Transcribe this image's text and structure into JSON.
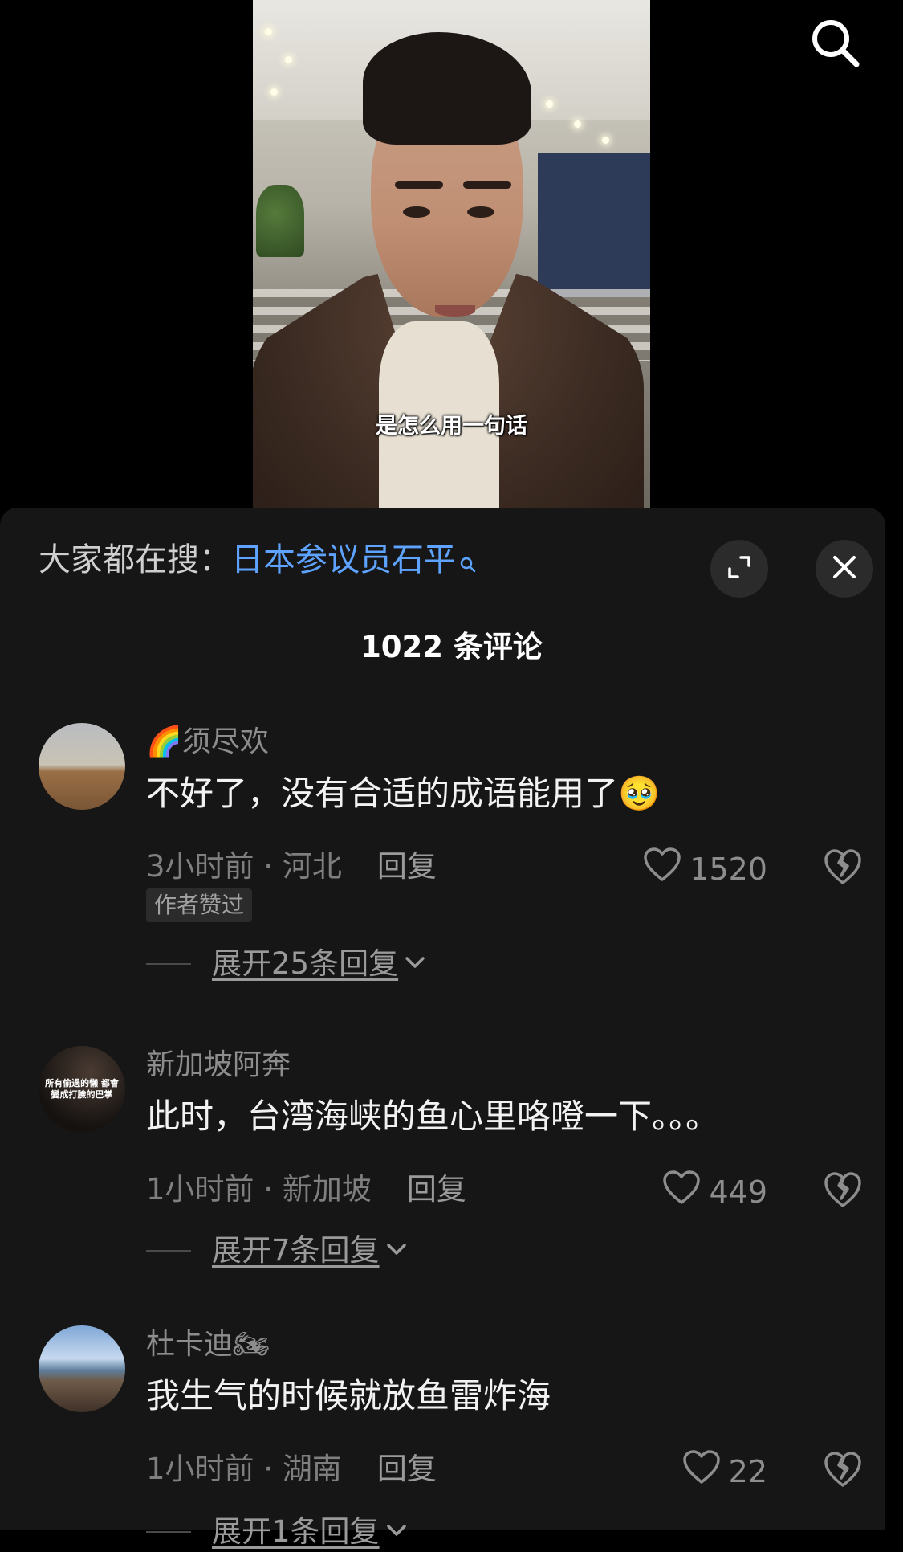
{
  "video": {
    "subtitle": "是怎么用一句话"
  },
  "trending": {
    "label": "大家都在搜：",
    "term": "日本参议员石平"
  },
  "comment_count_label": "1022 条评论",
  "comments": [
    {
      "username": "须尽欢",
      "username_prefix_emoji": "🌈",
      "text": "不好了，没有合适的成语能用了",
      "text_emoji": "🥹",
      "time": "3小时前",
      "location": "河北",
      "reply_label": "回复",
      "likes": "1520",
      "badge": "作者赞过",
      "expand_label": "展开25条回复"
    },
    {
      "username": "新加坡阿奔",
      "avatar_text": "所有偷過的懶 都會變成打臉的巴掌",
      "text": "此时，台湾海峡的鱼心里咯噔一下。。。",
      "time": "1小时前",
      "location": "新加坡",
      "reply_label": "回复",
      "likes": "449",
      "expand_label": "展开7条回复"
    },
    {
      "username": "杜卡迪",
      "username_suffix_emoji": "🏍",
      "text": "我生气的时候就放鱼雷炸海",
      "time": "1小时前",
      "location": "湖南",
      "reply_label": "回复",
      "likes": "22",
      "expand_label": "展开1条回复"
    }
  ],
  "colors": {
    "panel_bg": "#161616",
    "trending_term": "#5ea3ff",
    "meta_gray": "#7f7f7f"
  },
  "icons": [
    "search-icon",
    "expand-icon",
    "close-icon",
    "heart-icon",
    "dislike-icon",
    "chevron-down-icon"
  ]
}
